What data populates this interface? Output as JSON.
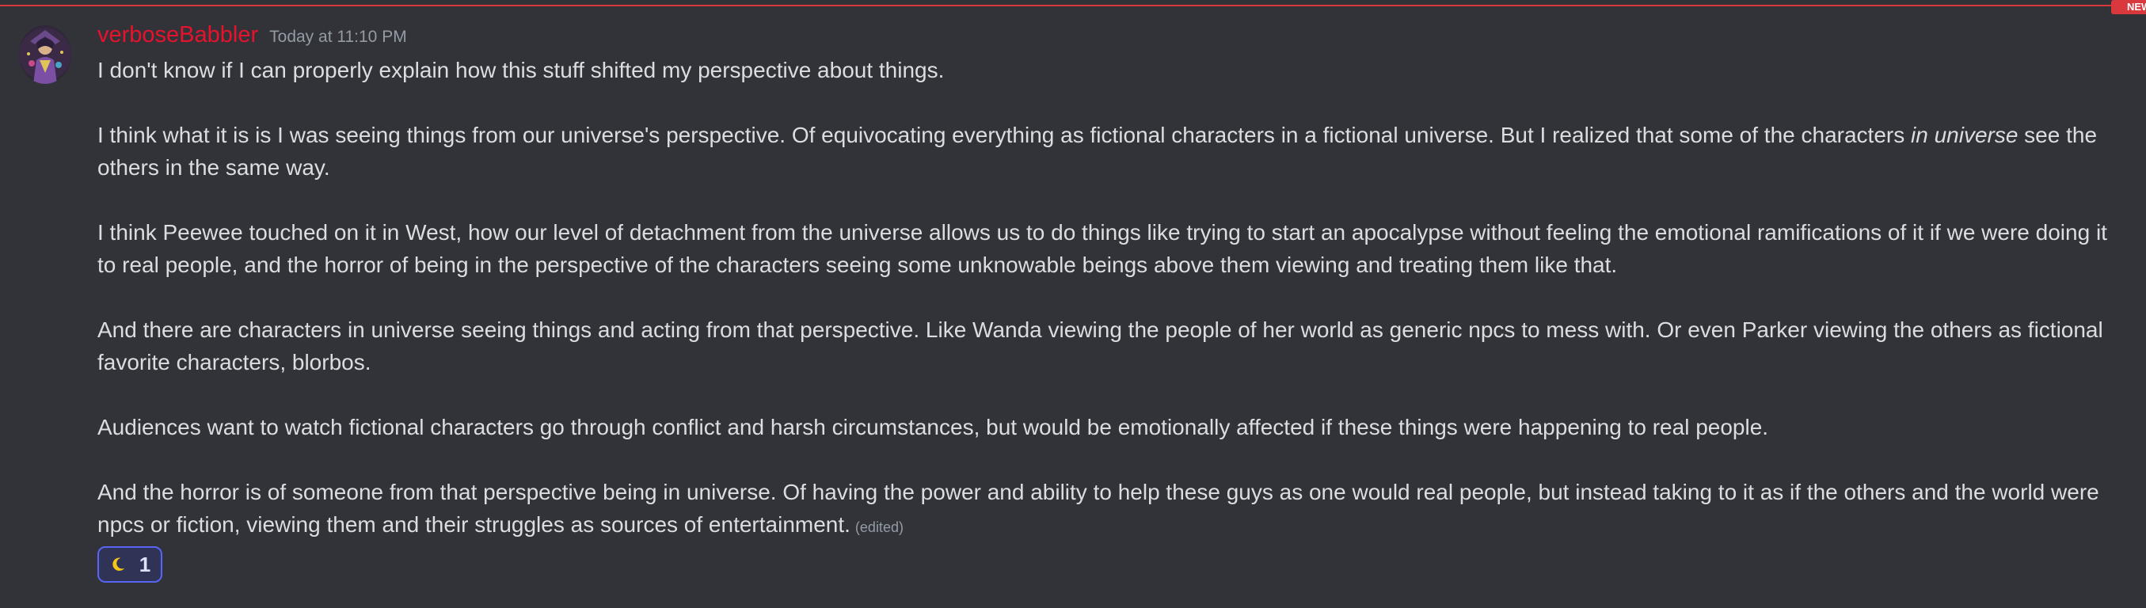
{
  "divider": {
    "badge_label": "NEW",
    "accent_color": "#d9383d"
  },
  "message": {
    "avatar_icon": "avatar-icon",
    "username": "verboseBabbler",
    "username_color": "#e8122c",
    "timestamp": "Today at 11:10 PM",
    "paragraphs": {
      "p1": "I don't know if I can properly explain how this stuff shifted my perspective about things.",
      "p2_before": "I think what it is is I was seeing things from our universe's perspective. Of equivocating everything as fictional characters in a fictional universe. But I realized that some of the characters ",
      "p2_italic": "in universe",
      "p2_after": " see the others in the same way.",
      "p3": "I think Peewee touched on it in West, how our level of detachment from the universe allows us to do things like trying to start an apocalypse without feeling the emotional ramifications of it if we were doing it to real people, and the horror of being in the perspective of the characters seeing some unknowable beings above them viewing and treating them like that.",
      "p4": "And there are characters in universe seeing things and acting from that perspective. Like Wanda viewing the people of her world as generic npcs to mess with. Or even Parker viewing the others as fictional favorite characters, blorbos.",
      "p5": "Audiences want to watch fictional characters go through conflict and harsh circumstances, but would be emotionally affected if these things were happening to real people.",
      "p6": "And the horror is of someone from that perspective being in universe. Of having the power and ability to help these guys as one would real people, but instead taking to it as if the others and the world were npcs or fiction, viewing them and their struggles as sources of entertainment."
    },
    "edited_label": "(edited)",
    "reaction": {
      "emoji": "crescent-moon-icon",
      "count": "1"
    }
  }
}
